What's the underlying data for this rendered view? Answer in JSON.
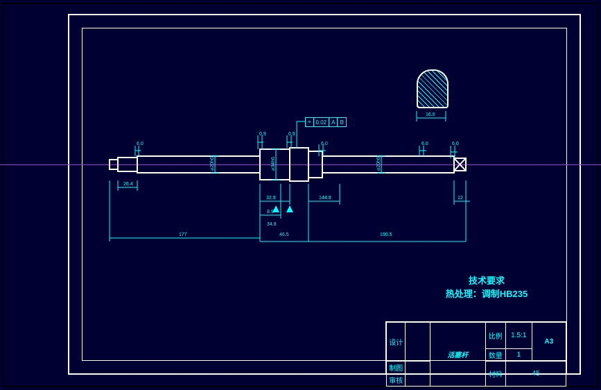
{
  "drawing": {
    "part_name": "活塞杆",
    "sheet_size": "A3",
    "tech_title": "技术要求",
    "tech_note": "热处理：调制HB235"
  },
  "title_block": {
    "scale_label": "比例",
    "scale_value": "1.5:1",
    "qty_label": "数量",
    "qty_value": "1",
    "material_label": "材料",
    "material_value": "45",
    "design_label": "设计",
    "drawn_label": "制图",
    "check_label": "审核"
  },
  "gtol": {
    "symbol": "⌖",
    "value": "0.02",
    "datum1": "A",
    "datum2": "B"
  },
  "dims": {
    "d1": "6.0",
    "d2": "6.0",
    "d3": "0.9",
    "d4": "0.9",
    "d5": "6.0",
    "d6": "6.0",
    "len1": "26.4",
    "len2": "177",
    "len3": "32.9",
    "len4": "8.9",
    "len5": "46.5",
    "len6": "144.9",
    "len7": "190.5",
    "len8": "34.8",
    "len9": "12",
    "diam1": "⌀20h6",
    "diam2": "⌀34h6",
    "diam3": "⌀20h6",
    "section_w": "16.0"
  }
}
